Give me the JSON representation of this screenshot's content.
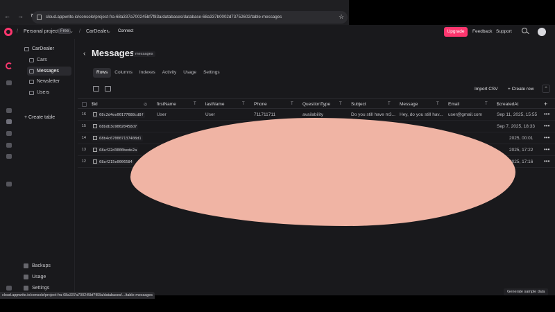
{
  "browser": {
    "url": "cloud.appwrite.io/console/project-fra-68a337a700245bf7f83a/databases/database-68a337b0002d73752602/table-messages"
  },
  "topbar": {
    "project": "Personal projects",
    "plan_badge": "Free",
    "org": "CarDealer",
    "connect": "Connect",
    "upgrade": "Upgrade",
    "feedback": "Feedback",
    "support": "Support"
  },
  "sidebar": {
    "database": "CarDealer",
    "items": [
      {
        "label": "Cars"
      },
      {
        "label": "Messages"
      },
      {
        "label": "Newsletter"
      },
      {
        "label": "Users"
      }
    ],
    "create_table": "Create table",
    "bottom": [
      {
        "label": "Backups"
      },
      {
        "label": "Usage"
      },
      {
        "label": "Settings"
      }
    ]
  },
  "page": {
    "title": "Messages",
    "table_id": "messages",
    "tabs": [
      "Rows",
      "Columns",
      "Indexes",
      "Activity",
      "Usage",
      "Settings"
    ],
    "import_csv": "Import CSV",
    "create_row": "Create row"
  },
  "grid": {
    "columns": [
      "$id",
      "firstName",
      "lastName",
      "Phone",
      "QuestionType",
      "Subject",
      "Message",
      "Email",
      "$createdAt"
    ],
    "rows": [
      {
        "num": "16",
        "id": "68c2d4ee00177688cd8f",
        "firstName": "User",
        "lastName": "User",
        "phone": "711711711",
        "questionType": "availability",
        "subject": "Do you still have m3...",
        "message": "Hey, do you still hav...",
        "email": "user@gmail.com",
        "createdAt": "Sep 11, 2025, 15:55"
      },
      {
        "num": "15",
        "id": "68bdb3e90020458d7",
        "firstName": "",
        "lastName": "",
        "phone": "",
        "questionType": "",
        "subject": "",
        "message": "",
        "email": "",
        "createdAt": "Sep 7, 2025, 18:33"
      },
      {
        "num": "14",
        "id": "68b4c670007137408d1",
        "firstName": "",
        "lastName": "",
        "phone": "",
        "questionType": "",
        "subject": "",
        "message": "",
        "email": "",
        "createdAt": "2025, 00:01"
      },
      {
        "num": "13",
        "id": "68af22d3000bede2a",
        "firstName": "",
        "lastName": "",
        "phone": "",
        "questionType": "",
        "subject": "",
        "message": "",
        "email": "",
        "createdAt": "2025, 17:22"
      },
      {
        "num": "12",
        "id": "68af215e0006584",
        "firstName": "",
        "lastName": "",
        "phone": "",
        "questionType": "",
        "subject": "",
        "message": "",
        "email": "",
        "createdAt": "2025, 17:16"
      }
    ]
  },
  "footer": {
    "generate": "Generate sample data",
    "status_url": "cloud.appwrite.io/console/project-fra-68a337a700245bf7f83a/databases/.../table-messages"
  }
}
